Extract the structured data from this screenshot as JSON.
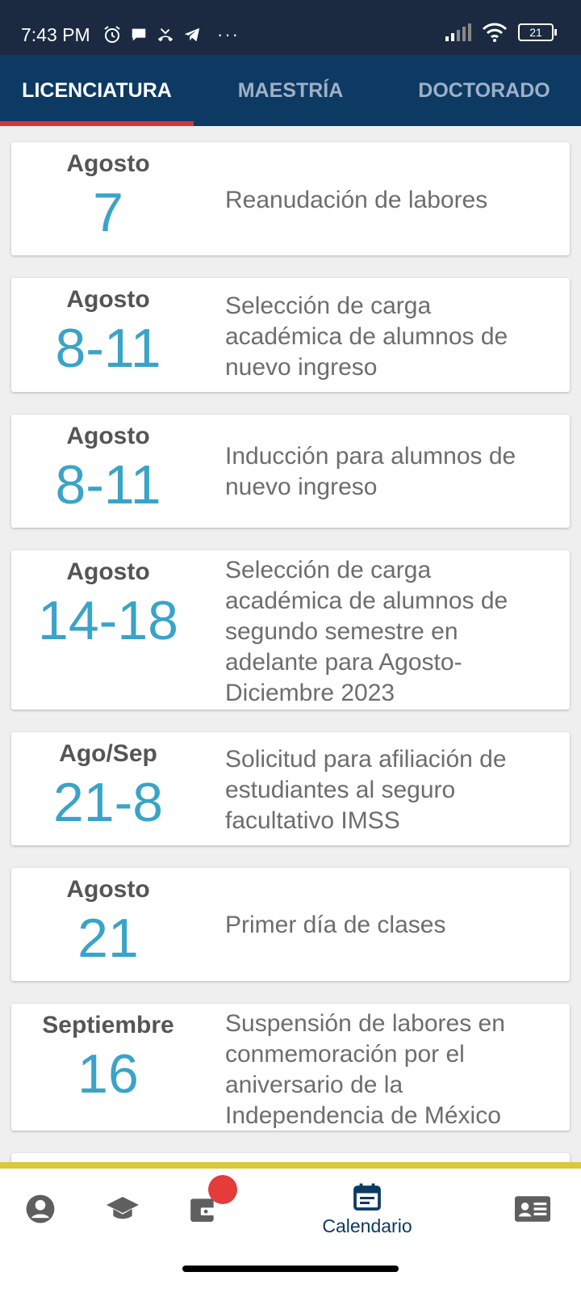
{
  "status": {
    "time": "7:43 PM",
    "battery": "21",
    "icons": [
      "alarm-icon",
      "chat-icon",
      "missed-call-icon",
      "telegram-icon",
      "more-dots-icon",
      "signal-icon",
      "wifi-icon",
      "battery-icon"
    ]
  },
  "tabs": [
    {
      "label": "LICENCIATURA",
      "active": true
    },
    {
      "label": "MAESTRÍA",
      "active": false
    },
    {
      "label": "DOCTORADO",
      "active": false
    }
  ],
  "events": [
    {
      "month": "Agosto",
      "day": "7",
      "desc": "Reanudación de labores"
    },
    {
      "month": "Agosto",
      "day": "8-11",
      "desc": "Selección de carga académica de alumnos de nuevo ingreso"
    },
    {
      "month": "Agosto",
      "day": "8-11",
      "desc": "Inducción para alumnos de nuevo ingreso"
    },
    {
      "month": "Agosto",
      "day": "14-18",
      "desc": "Selección de carga académica de alumnos de segundo semestre en adelante para Agosto-Diciembre 2023"
    },
    {
      "month": "Ago/Sep",
      "day": "21-8",
      "desc": "Solicitud para afiliación de estudiantes al seguro facultativo IMSS"
    },
    {
      "month": "Agosto",
      "day": "21",
      "desc": "Primer día de clases"
    },
    {
      "month": "Septiembre",
      "day": "16",
      "desc": "Suspensión de labores en conmemoración por el aniversario de la Independencia de México"
    }
  ],
  "nav": {
    "items": [
      "profile-icon",
      "graduation-cap-icon",
      "wallet-icon",
      "calendar-icon",
      "id-card-icon"
    ],
    "active_label": "Calendario"
  },
  "colors": {
    "tab_bg": "#0d3a63",
    "status_bg": "#1b2a40",
    "accent_red": "#d7353c",
    "date_blue": "#3aa3c8",
    "strip_yellow": "#d9c93a"
  }
}
